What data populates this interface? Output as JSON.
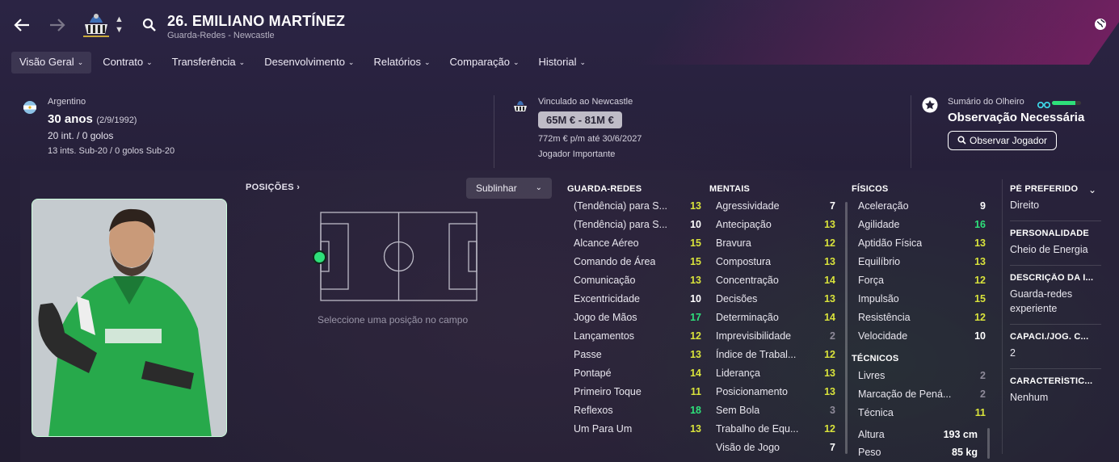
{
  "header": {
    "player_name": "26. EMILIANO MARTÍNEZ",
    "player_sub": "Guarda-Redes - Newcastle"
  },
  "menu": [
    {
      "label": "Visão Geral"
    },
    {
      "label": "Contrato"
    },
    {
      "label": "Transferência"
    },
    {
      "label": "Desenvolvimento"
    },
    {
      "label": "Relatórios"
    },
    {
      "label": "Comparação"
    },
    {
      "label": "Historial"
    }
  ],
  "info": {
    "nation": "Argentino",
    "age": "30 anos",
    "dob": "(2/9/1992)",
    "caps": "20 int. / 0 golos",
    "u20": "13 ints. Sub-20 / 0 golos Sub-20",
    "club_status": "Vinculado ao Newcastle",
    "value": "65M € - 81M €",
    "wage": "772m € p/m até 30/6/2027",
    "role": "Jogador Importante",
    "scout_label": "Sumário do Olheiro",
    "scout_status": "Observação Necessária",
    "scout_button": "Observar Jogador",
    "scout_knowledge": 0.8
  },
  "positions": {
    "title": "POSIÇÕES",
    "dropdown": "Sublinhar",
    "hint": "Seleccione uma posição no campo"
  },
  "gk": {
    "title": "GUARDA-REDES",
    "items": [
      {
        "name": "(Tendência) para S...",
        "value": "13"
      },
      {
        "name": "(Tendência) para S...",
        "value": "10"
      },
      {
        "name": "Alcance Aéreo",
        "value": "15"
      },
      {
        "name": "Comando de Área",
        "value": "15"
      },
      {
        "name": "Comunicação",
        "value": "13"
      },
      {
        "name": "Excentricidade",
        "value": "10"
      },
      {
        "name": "Jogo de Mãos",
        "value": "17"
      },
      {
        "name": "Lançamentos",
        "value": "12"
      },
      {
        "name": "Passe",
        "value": "13"
      },
      {
        "name": "Pontapé",
        "value": "14"
      },
      {
        "name": "Primeiro Toque",
        "value": "11"
      },
      {
        "name": "Reflexos",
        "value": "18"
      },
      {
        "name": "Um Para Um",
        "value": "13"
      }
    ]
  },
  "mental": {
    "title": "MENTAIS",
    "items": [
      {
        "name": "Agressividade",
        "value": "7"
      },
      {
        "name": "Antecipação",
        "value": "13"
      },
      {
        "name": "Bravura",
        "value": "12"
      },
      {
        "name": "Compostura",
        "value": "13"
      },
      {
        "name": "Concentração",
        "value": "14"
      },
      {
        "name": "Decisões",
        "value": "13"
      },
      {
        "name": "Determinação",
        "value": "14"
      },
      {
        "name": "Imprevisibilidade",
        "value": "2"
      },
      {
        "name": "Índice de Trabal...",
        "value": "12"
      },
      {
        "name": "Liderança",
        "value": "13"
      },
      {
        "name": "Posicionamento",
        "value": "13"
      },
      {
        "name": "Sem Bola",
        "value": "3"
      },
      {
        "name": "Trabalho de Equ...",
        "value": "12"
      },
      {
        "name": "Visão de Jogo",
        "value": "7"
      }
    ]
  },
  "physical": {
    "title": "FÍSICOS",
    "items": [
      {
        "name": "Aceleração",
        "value": "9"
      },
      {
        "name": "Agilidade",
        "value": "16"
      },
      {
        "name": "Aptidão Física",
        "value": "13"
      },
      {
        "name": "Equilíbrio",
        "value": "13"
      },
      {
        "name": "Força",
        "value": "12"
      },
      {
        "name": "Impulsão",
        "value": "15"
      },
      {
        "name": "Resistência",
        "value": "12"
      },
      {
        "name": "Velocidade",
        "value": "10"
      }
    ]
  },
  "technical": {
    "title": "TÉCNICOS",
    "items": [
      {
        "name": "Livres",
        "value": "2"
      },
      {
        "name": "Marcação de Pená...",
        "value": "2"
      },
      {
        "name": "Técnica",
        "value": "11"
      }
    ]
  },
  "body": {
    "height_label": "Altura",
    "height": "193 cm",
    "weight_label": "Peso",
    "weight": "85 kg"
  },
  "side": [
    {
      "title": "PÉ PREFERIDO",
      "value": "Direito"
    },
    {
      "title": "PERSONALIDADE",
      "value": "Cheio de Energia"
    },
    {
      "title": "DESCRIÇÃO DA I...",
      "value": "Guarda-redes experiente"
    },
    {
      "title": "CAPACI./JOG. C...",
      "value": "2"
    },
    {
      "title": "CARACTERÍSTIC...",
      "value": "Nenhum"
    }
  ],
  "colors": {
    "high": "#2ee07a",
    "good": "#d9e33b",
    "mid": "#ffffff",
    "low": "#8e8a99",
    "accent": "#aa1e78"
  }
}
